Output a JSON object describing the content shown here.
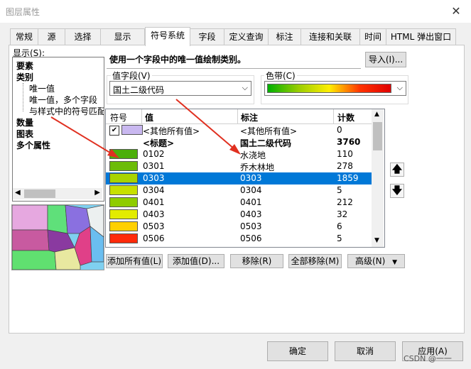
{
  "window": {
    "title": "图层属性",
    "close_glyph": "✕"
  },
  "tabs": [
    {
      "label": "常规"
    },
    {
      "label": "源"
    },
    {
      "label": "选择"
    },
    {
      "label": "显示"
    },
    {
      "label": "符号系统"
    },
    {
      "label": "字段"
    },
    {
      "label": "定义查询"
    },
    {
      "label": "标注"
    },
    {
      "label": "连接和关联"
    },
    {
      "label": "时间"
    },
    {
      "label": "HTML 弹出窗口"
    }
  ],
  "show": {
    "label": "显示(S):",
    "items": [
      {
        "text": "要素",
        "bold": true
      },
      {
        "text": "类别",
        "bold": true
      },
      {
        "text": "唯一值",
        "bold": false
      },
      {
        "text": "唯一值，多个字段",
        "bold": false
      },
      {
        "text": "与样式中的符号匹配",
        "bold": false
      },
      {
        "text": "数量",
        "bold": true
      },
      {
        "text": "图表",
        "bold": true
      },
      {
        "text": "多个属性",
        "bold": true
      }
    ]
  },
  "description": "使用一个字段中的唯一值绘制类别。",
  "import_button": "导入(I)...",
  "value_field": {
    "label": "值字段(V)",
    "value": "国土二级代码"
  },
  "color_ramp": {
    "label": "色带(C)",
    "colors": [
      "#00b000",
      "#9acd00",
      "#ffee00",
      "#ff3300",
      "#e00000"
    ]
  },
  "grid": {
    "headers": {
      "symbol": "符号",
      "value": "值",
      "label": "标注",
      "count": "计数"
    },
    "rows": [
      {
        "checked": true,
        "color": "#c9b8f0",
        "value": "<其他所有值>",
        "label": "<其他所有值>",
        "count": "0",
        "bold": false,
        "selected": false
      },
      {
        "checked": false,
        "color": "",
        "value": "<标题>",
        "label": "国土二级代码",
        "count": "3760",
        "bold": true,
        "selected": false
      },
      {
        "checked": false,
        "color": "#4caf0a",
        "value": "0102",
        "label": "水浇地",
        "count": "110",
        "bold": false,
        "selected": false
      },
      {
        "checked": false,
        "color": "#6cbc08",
        "value": "0301",
        "label": "乔木林地",
        "count": "278",
        "bold": false,
        "selected": false
      },
      {
        "checked": false,
        "color": "#a8d400",
        "value": "0303",
        "label": "0303",
        "count": "1859",
        "bold": false,
        "selected": true
      },
      {
        "checked": false,
        "color": "#c7e000",
        "value": "0304",
        "label": "0304",
        "count": "5",
        "bold": false,
        "selected": false
      },
      {
        "checked": false,
        "color": "#8fcc00",
        "value": "0401",
        "label": "0401",
        "count": "212",
        "bold": false,
        "selected": false
      },
      {
        "checked": false,
        "color": "#e3ec00",
        "value": "0403",
        "label": "0403",
        "count": "32",
        "bold": false,
        "selected": false
      },
      {
        "checked": false,
        "color": "#ffd000",
        "value": "0503",
        "label": "0503",
        "count": "6",
        "bold": false,
        "selected": false
      },
      {
        "checked": false,
        "color": "#ff2a0a",
        "value": "0506",
        "label": "0506",
        "count": "5",
        "bold": false,
        "selected": false
      }
    ]
  },
  "action_buttons": {
    "add_all": "添加所有值(L)",
    "add": "添加值(D)...",
    "remove": "移除(R)",
    "remove_all": "全部移除(M)",
    "advanced": "高级(N)"
  },
  "footer": {
    "ok": "确定",
    "cancel": "取消",
    "apply": "应用(A)",
    "watermark": "CSDN @一一"
  }
}
